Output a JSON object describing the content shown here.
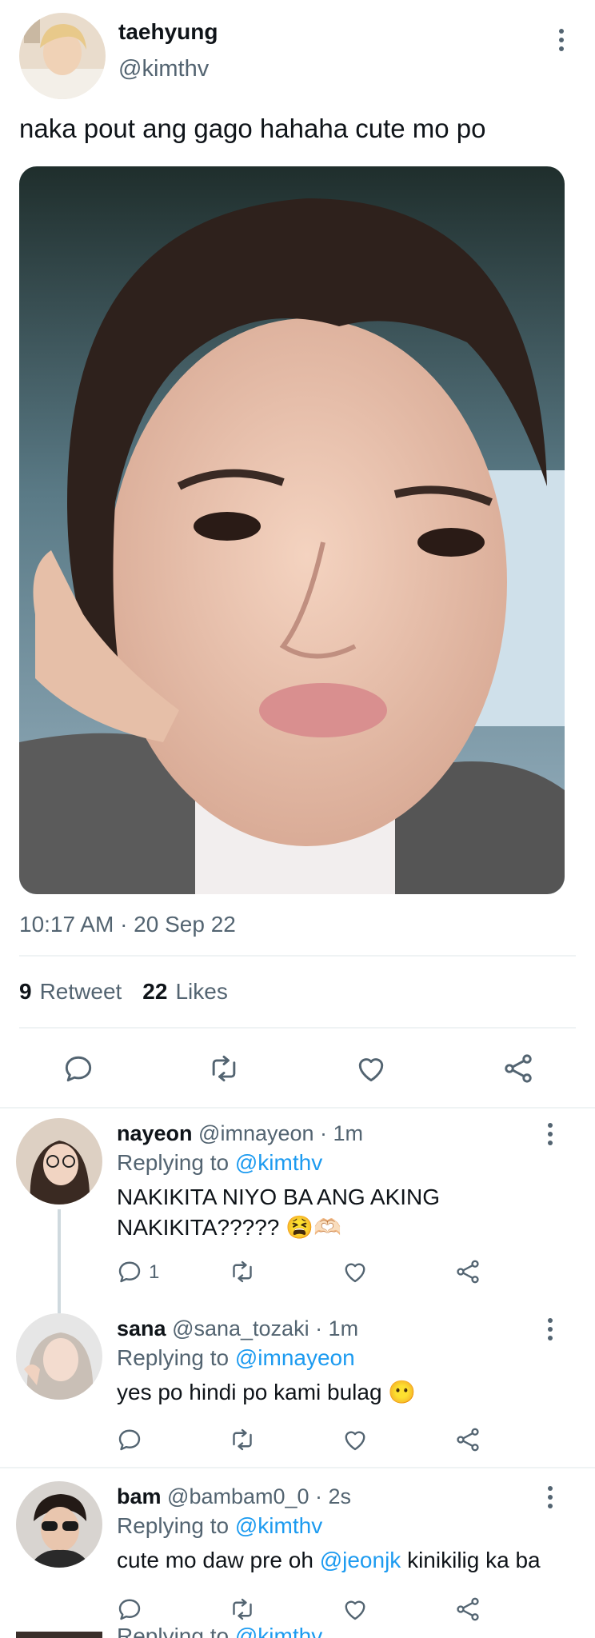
{
  "tweet": {
    "author_name": "taehyung",
    "author_handle": "@kimthv",
    "text": "naka pout ang gago hahaha cute mo po",
    "timestamp": "10:17 AM · 20 Sep 22",
    "retweets_count": "9",
    "retweets_label": "Retweet",
    "likes_count": "22",
    "likes_label": "Likes"
  },
  "replies": [
    {
      "name": "nayeon",
      "handle_time": "@imnayeon · 1m",
      "replying_prefix": "Replying to",
      "replying_to": "@kimthv",
      "text_line1": "NAKIKITA NIYO BA ANG AKING",
      "text_line2": "NAKIKITA?????",
      "emoji": "😫🫶🏻",
      "reply_count": "1"
    },
    {
      "name": "sana",
      "handle_time": "@sana_tozaki · 1m",
      "replying_prefix": "Replying to",
      "replying_to": "@imnayeon",
      "text": "yes po hindi po kami bulag",
      "emoji": "😶"
    },
    {
      "name": "bam",
      "handle_time": "@bambam0_0 · 2s",
      "replying_prefix": "Replying to",
      "replying_to": "@kimthv",
      "text_before": "cute mo daw pre oh",
      "mention": "@jeonjk",
      "text_after": "kinikilig ka ba"
    }
  ],
  "partial_next": {
    "replying_prefix": "Replying to",
    "replying_to": "@kimthv"
  },
  "colors": {
    "link": "#1d9bf0",
    "secondary_text": "#536471",
    "primary_text": "#0f1419",
    "divider": "#eff3f4"
  },
  "icons": [
    "reply-icon",
    "retweet-icon",
    "like-icon",
    "share-icon",
    "more-icon"
  ]
}
